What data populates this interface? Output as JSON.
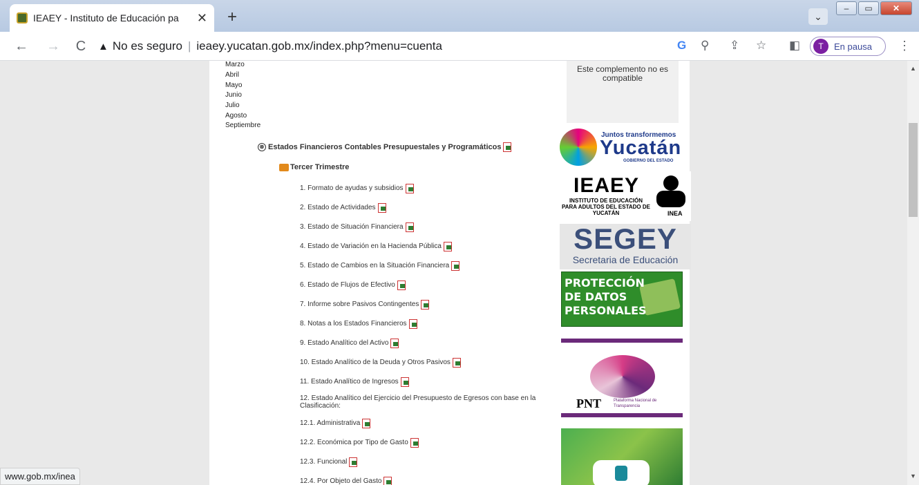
{
  "tab": {
    "title": "IEAEY - Instituto de Educación pa",
    "close": "✕"
  },
  "newtab": "+",
  "window": {
    "tab_search": "⌄",
    "minimize": "–",
    "maximize": "▭",
    "close": "✕"
  },
  "toolbar": {
    "back": "←",
    "forward": "→",
    "reload": "C",
    "warn_icon": "▲",
    "security": "No es seguro",
    "separator": "|",
    "url": "ieaey.yucatan.gob.mx/index.php?menu=cuenta",
    "google": "G",
    "zoom": "⚲",
    "share": "⇪",
    "star": "☆",
    "sidepanel": "◧",
    "profile_initial": "T",
    "profile_label": "En pausa",
    "menu": "⋮"
  },
  "months": [
    "Marzo",
    "Abril",
    "Mayo",
    "Junio",
    "Julio",
    "Agosto",
    "Septiembre"
  ],
  "section": {
    "icon": "⊗",
    "title": "Estados Financieros Contables Presupuestales y Programáticos"
  },
  "subsection": {
    "title": "Tercer Trimestre"
  },
  "items": [
    "1. Formato de ayudas y subsidios",
    "2. Estado de Actividades",
    "3. Estado de Situación Financiera",
    "4. Estado de Variación en la Hacienda Pública",
    "5. Estado de Cambios en la Situación Financiera",
    "6. Estado de Flujos de Efectivo",
    "7. Informe sobre Pasivos Contingentes",
    "8. Notas a los Estados Financieros",
    "9. Estado Analítico del Activo",
    "10. Estado Analítico de la Deuda y Otros Pasivos",
    "11. Estado Analítico de Ingresos",
    "12. Estado Analítico del Ejercicio del Presupuesto de Egresos con base en la Clasificación:",
    "12.1. Administrativa",
    "12.2. Económica por Tipo de Gasto",
    "12.3. Funcional",
    "12.4. Por Objeto del Gasto"
  ],
  "sidebar": {
    "plugin_msg": "Este complemento no es compatible",
    "juntos_top": "Juntos transformemos",
    "juntos_main": "Yucatán",
    "juntos_sub": "GOBIERNO DEL ESTADO",
    "ieaey_title": "IEAEY",
    "ieaey_sub": "INSTITUTO DE EDUCACIÓN PARA ADULTOS DEL ESTADO DE YUCATÁN",
    "inea": "INEA",
    "segey_title": "SEGEY",
    "segey_sub": "Secretaria de Educación",
    "proteccion": "PROTECCIÓN DE DATOS PERSONALES",
    "pnt": "PNT",
    "pnt_sub": "Plataforma Nacional de Transparencia"
  },
  "status_url": "www.gob.mx/inea",
  "scroll": {
    "up": "▲",
    "down": "▼"
  }
}
